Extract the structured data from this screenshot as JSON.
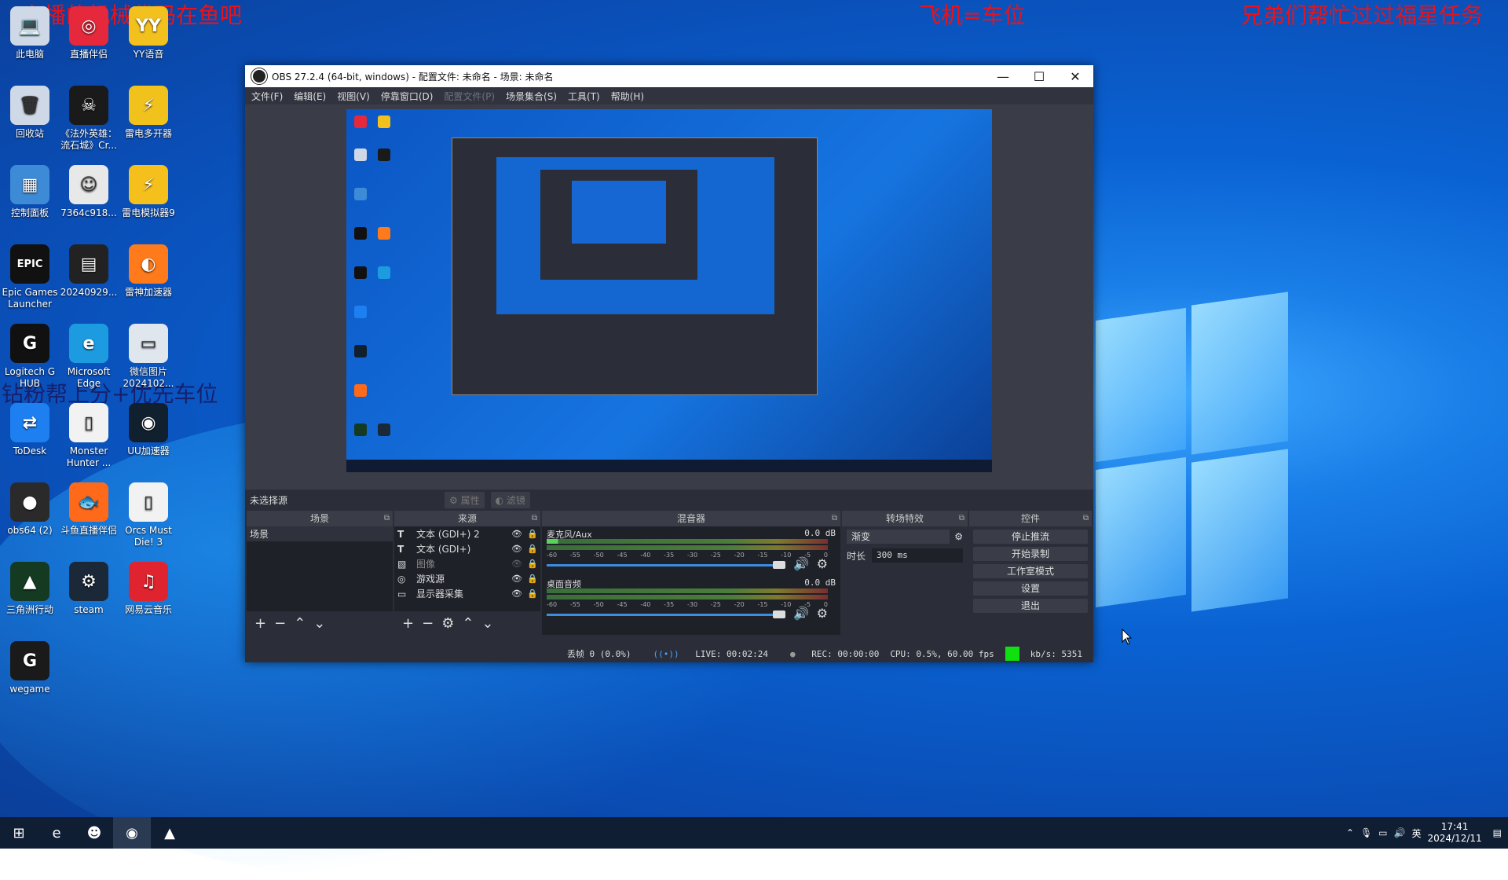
{
  "overlays": {
    "top_left": "主播的机械代码在鱼吧",
    "top_mid": "飞机=车位",
    "top_right": "兄弟们帮忙过过福星任务",
    "mid_left": "钻粉帮上分+优先车位"
  },
  "desktop_icons": [
    {
      "label": "此电脑",
      "glyph": "💻",
      "bg": "#cfd8e6"
    },
    {
      "label": "直播伴侣",
      "glyph": "◎",
      "bg": "#e6283c"
    },
    {
      "label": "YY语音",
      "glyph": "YY",
      "bg": "#f3c11d"
    },
    {
      "label": "回收站",
      "glyph": "🗑",
      "bg": "#cfd8e6"
    },
    {
      "label": "《法外英雄：流石城》Cr...",
      "glyph": "☠",
      "bg": "#1a1a1a"
    },
    {
      "label": "雷电多开器",
      "glyph": "⚡",
      "bg": "#f2c21c"
    },
    {
      "label": "控制面板",
      "glyph": "▦",
      "bg": "#3d8ad6"
    },
    {
      "label": "7364c918...",
      "glyph": "☺",
      "bg": "#e8e8e8"
    },
    {
      "label": "雷电模拟器9",
      "glyph": "⚡",
      "bg": "#f5c01b"
    },
    {
      "label": "Epic Games Launcher",
      "glyph": "EPIC",
      "bg": "#111"
    },
    {
      "label": "20240929...",
      "glyph": "▤",
      "bg": "#222"
    },
    {
      "label": "雷神加速器",
      "glyph": "◐",
      "bg": "#ff7a1a"
    },
    {
      "label": "Logitech G HUB",
      "glyph": "G",
      "bg": "#111"
    },
    {
      "label": "Microsoft Edge",
      "glyph": "e",
      "bg": "#1c9be0"
    },
    {
      "label": "微信图片 2024102...",
      "glyph": "▭",
      "bg": "#dfe6ee"
    },
    {
      "label": "ToDesk",
      "glyph": "⇄",
      "bg": "#1d7ff0"
    },
    {
      "label": "Monster Hunter ...",
      "glyph": "▯",
      "bg": "#f2f2f2"
    },
    {
      "label": "UU加速器",
      "glyph": "◉",
      "bg": "#10202e"
    },
    {
      "label": "obs64 (2)",
      "glyph": "●",
      "bg": "#2a2a2a"
    },
    {
      "label": "斗鱼直播伴侣",
      "glyph": "🐟",
      "bg": "#ff6a1a"
    },
    {
      "label": "Orcs Must Die! 3",
      "glyph": "▯",
      "bg": "#f2f2f2"
    },
    {
      "label": "三角洲行动",
      "glyph": "▲",
      "bg": "#143a22"
    },
    {
      "label": "steam",
      "glyph": "⚙",
      "bg": "#1b2838"
    },
    {
      "label": "网易云音乐",
      "glyph": "♫",
      "bg": "#e0242f"
    },
    {
      "label": "wegame",
      "glyph": "G",
      "bg": "#1a1a1a"
    }
  ],
  "window": {
    "title": "OBS 27.2.4 (64-bit, windows) - 配置文件: 未命名 - 场景: 未命名",
    "minimize": "—",
    "maximize": "☐",
    "close": "✕"
  },
  "menu": [
    "文件(F)",
    "编辑(E)",
    "视图(V)",
    "停靠窗口(D)",
    "配置文件(P)",
    "场景集合(S)",
    "工具(T)",
    "帮助(H)"
  ],
  "source_toolbar": {
    "no_source": "未选择源",
    "properties": "属性",
    "filters": "滤镜"
  },
  "docks": {
    "scenes": {
      "title": "场景",
      "items": [
        "场景"
      ]
    },
    "sources": {
      "title": "来源",
      "items": [
        {
          "icon": "T",
          "label": "文本 (GDI+) 2",
          "visible": true
        },
        {
          "icon": "T",
          "label": "文本 (GDI+)",
          "visible": true
        },
        {
          "icon": "▧",
          "label": "图像",
          "visible": false
        },
        {
          "icon": "◎",
          "label": "游戏源",
          "visible": true
        },
        {
          "icon": "▭",
          "label": "显示器采集",
          "visible": true
        }
      ]
    },
    "mixer": {
      "title": "混音器",
      "channels": [
        {
          "name": "麦克风/Aux",
          "db": "0.0 dB"
        },
        {
          "name": "桌面音频",
          "db": "0.0 dB"
        }
      ],
      "ticks": [
        "-60",
        "-55",
        "-50",
        "-45",
        "-40",
        "-35",
        "-30",
        "-25",
        "-20",
        "-15",
        "-10",
        "-5",
        "0"
      ]
    },
    "transitions": {
      "title": "转场特效",
      "selected": "渐变",
      "duration_label": "时长",
      "duration": "300 ms"
    },
    "controls": {
      "title": "控件",
      "buttons": [
        "停止推流",
        "开始录制",
        "工作室模式",
        "设置",
        "退出"
      ]
    }
  },
  "status": {
    "dropped": "丢帧 0 (0.0%)",
    "live": "LIVE: 00:02:24",
    "rec": "REC: 00:00:00",
    "cpu": "CPU: 0.5%, 60.00 fps",
    "kbps": "kb/s: 5351"
  },
  "taskbar": {
    "items": [
      {
        "name": "start",
        "glyph": "⊞"
      },
      {
        "name": "edge",
        "glyph": "e"
      },
      {
        "name": "yy",
        "glyph": "☻"
      },
      {
        "name": "obs",
        "glyph": "◉"
      },
      {
        "name": "delta-force",
        "glyph": "▲"
      }
    ],
    "ime": "英",
    "time": "17:41",
    "date": "2024/12/11"
  }
}
